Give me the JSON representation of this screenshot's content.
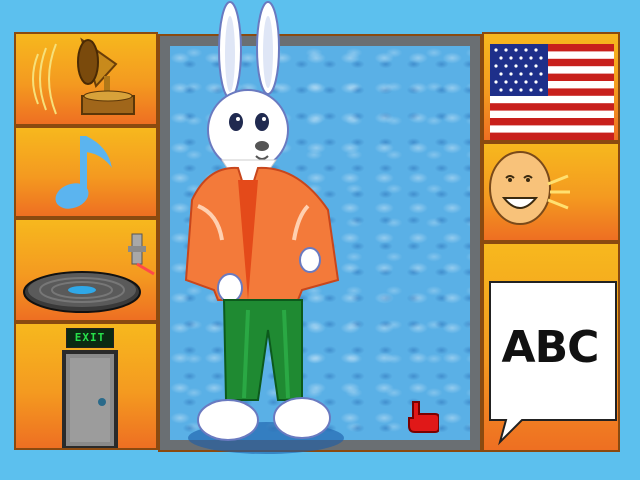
{
  "menu": {
    "left": [
      {
        "name": "phonograph-button",
        "icon": "gramophone-icon"
      },
      {
        "name": "music-button",
        "icon": "music-note-icon"
      },
      {
        "name": "record-player-button",
        "icon": "turntable-icon"
      },
      {
        "name": "exit-button",
        "icon": "door-icon",
        "sign_label": "EXIT"
      }
    ],
    "right": [
      {
        "name": "language-button",
        "icon": "us-flag-icon"
      },
      {
        "name": "speak-button",
        "icon": "talking-face-icon"
      },
      {
        "name": "alphabet-button",
        "icon": "speech-bubble-icon",
        "label": "ABC"
      }
    ]
  },
  "character": {
    "name": "rabbit",
    "icon": "rabbit-in-orange-jacket"
  },
  "cursor": {
    "icon": "pointing-hand-cursor"
  },
  "colors": {
    "tile_top": "#f7b81e",
    "tile_bottom": "#ee6f22",
    "water": "#5ab0e6",
    "frame": "#6a6f73",
    "background": "#5cc0ee"
  }
}
